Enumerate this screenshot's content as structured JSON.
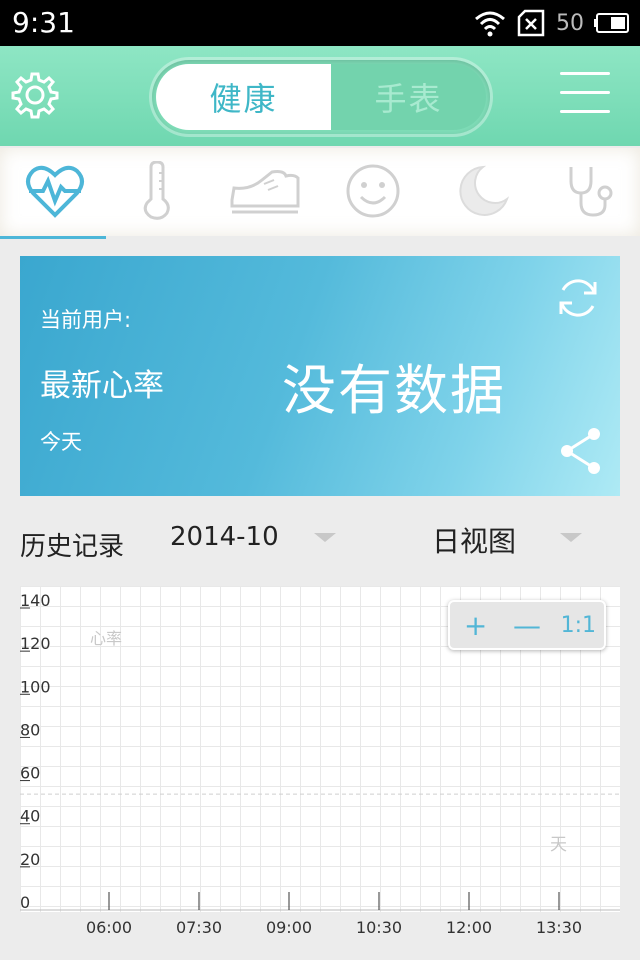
{
  "statusbar": {
    "time": "9:31",
    "battery": "50"
  },
  "header": {
    "tab_health": "健康",
    "tab_watch": "手表"
  },
  "categories": [
    {
      "name": "heartbeat-icon",
      "active": true
    },
    {
      "name": "thermometer-icon",
      "active": false
    },
    {
      "name": "shoe-icon",
      "active": false
    },
    {
      "name": "smiley-icon",
      "active": false
    },
    {
      "name": "moon-icon",
      "active": false
    },
    {
      "name": "stethoscope-icon",
      "active": false
    }
  ],
  "card": {
    "user_label": "当前用户:",
    "hr_label": "最新心率",
    "today_label": "今天",
    "no_data": "没有数据"
  },
  "history": {
    "label": "历史记录",
    "date": "2014-10",
    "view": "日视图"
  },
  "zoom": {
    "plus": "+",
    "minus": "—",
    "reset": "1:1"
  },
  "colors": {
    "accent": "#4db6d8",
    "header": "#7edcb7"
  },
  "chart_data": {
    "type": "line",
    "series": [
      {
        "name": "心率",
        "values": []
      }
    ],
    "ylabel": "心率",
    "xlabel": "天",
    "ylim": [
      0,
      140
    ],
    "yticks": [
      "140",
      "120",
      "100",
      "80",
      "60",
      "40",
      "20",
      "0"
    ],
    "xticks": [
      "06:00",
      "07:30",
      "09:00",
      "10:30",
      "12:00",
      "13:30"
    ],
    "reference_line": 50,
    "grid": true
  }
}
